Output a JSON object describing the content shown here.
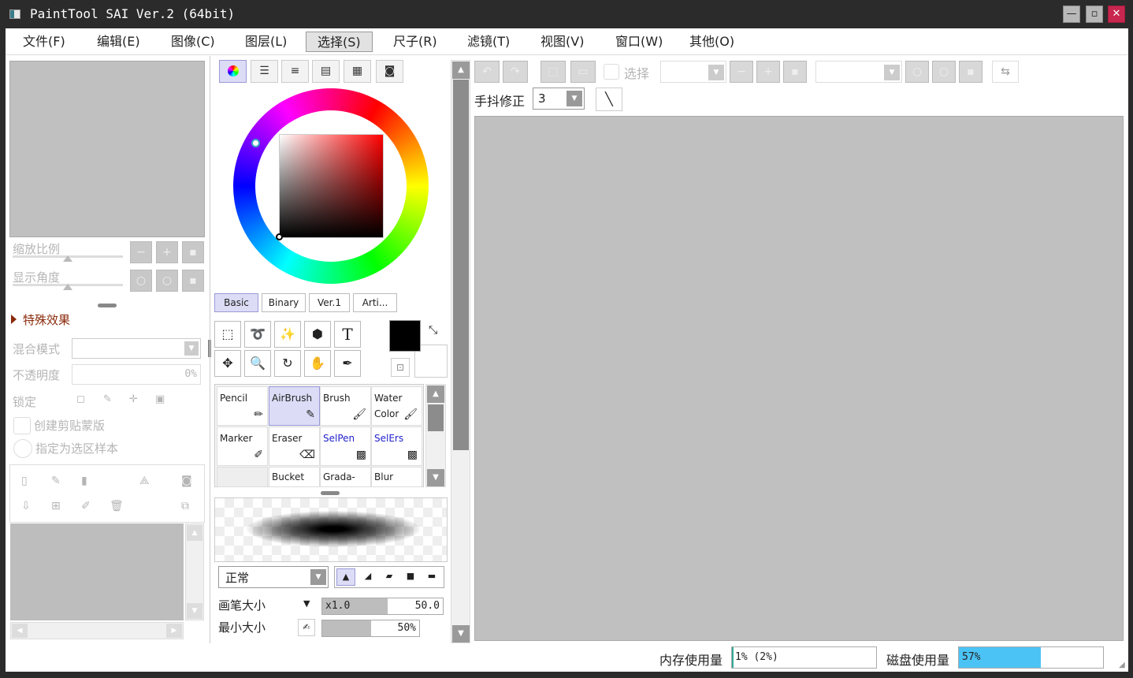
{
  "window": {
    "title": "PaintTool SAI Ver.2 (64bit)"
  },
  "menu": [
    "文件(F)",
    "编辑(E)",
    "图像(C)",
    "图层(L)",
    "选择(S)",
    "尺子(R)",
    "滤镜(T)",
    "视图(V)",
    "窗口(W)",
    "其他(O)"
  ],
  "navigator": {
    "zoom_label": "缩放比例",
    "angle_label": "显示角度"
  },
  "layer_panel": {
    "effects_label": "特殊效果",
    "blend_label": "混合模式",
    "opacity_label": "不透明度",
    "opacity_value": "0%",
    "lock_label": "锁定",
    "clip_label": "创建剪贴蒙版",
    "sample_label": "指定为选区样本"
  },
  "color_tabs": [
    "Basic",
    "Binary",
    "Ver.1",
    "Arti..."
  ],
  "colors": {
    "primary": "#000000",
    "secondary": "#ffffff",
    "hue": "#ff0000",
    "accent": "#9a9ad8"
  },
  "brushes": [
    {
      "name": "Pencil",
      "icon": "pencil-icon",
      "special": false
    },
    {
      "name": "AirBrush",
      "icon": "airbrush-icon",
      "special": false,
      "selected": true
    },
    {
      "name": "Brush",
      "icon": "brush-icon",
      "special": false
    },
    {
      "name": "Water Color",
      "icon": "watercolor-icon",
      "special": false
    },
    {
      "name": "Marker",
      "icon": "marker-icon",
      "special": false
    },
    {
      "name": "Eraser",
      "icon": "eraser-icon",
      "special": false
    },
    {
      "name": "SelPen",
      "icon": "selpen-icon",
      "special": true
    },
    {
      "name": "SelErs",
      "icon": "selers-icon",
      "special": true
    },
    {
      "name": "",
      "icon": "",
      "special": false
    },
    {
      "name": "Bucket",
      "icon": "",
      "special": false
    },
    {
      "name": "Grada-",
      "icon": "",
      "special": false
    },
    {
      "name": "Blur",
      "icon": "",
      "special": false
    }
  ],
  "brush_settings": {
    "blend_mode": "正常",
    "size_label": "画笔大小",
    "size_multiplier": "x1.0",
    "size_value": "50.0",
    "min_size_label": "最小大小",
    "min_size_value": "50%",
    "min_size_percent": 50,
    "size_fill_percent": 54
  },
  "canvas_toolbar": {
    "select_label": "选择",
    "stabilizer_label": "手抖修正",
    "stabilizer_value": "3"
  },
  "status": {
    "memory_label": "内存使用量",
    "memory_value": "1% (2%)",
    "memory_percent": 1,
    "disk_label": "磁盘使用量",
    "disk_value": "57%",
    "disk_percent": 57
  }
}
